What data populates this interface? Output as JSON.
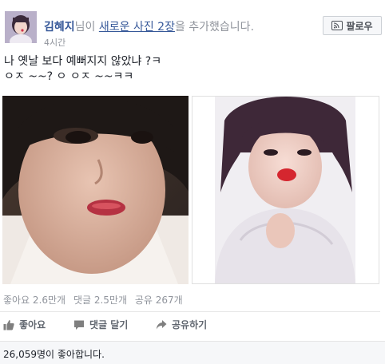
{
  "post": {
    "author": "김혜지",
    "action_prefix": "님이 ",
    "action_link": "새로운 사진 2장",
    "action_suffix": "을 추가했습니다.",
    "timestamp": "4시간",
    "follow_label": "팔로우",
    "message_line1": "나 옛날 보다 예뻐지지 않았냐 ?ㅋ",
    "message_line2": "ㅇㅈ ~~? ㅇ ㅇㅈ ~~ㅋㅋ"
  },
  "stats": {
    "likes": "좋아요 2.6만개",
    "comments": "댓글 2.5만개",
    "shares": "공유 267개"
  },
  "actions": {
    "like": "좋아요",
    "comment": "댓글 달기",
    "share": "공유하기"
  },
  "summary": {
    "likes_text": "26,059명이 좋아합니다."
  },
  "colors": {
    "link": "#365899",
    "muted": "#90949c",
    "action": "#616770"
  }
}
